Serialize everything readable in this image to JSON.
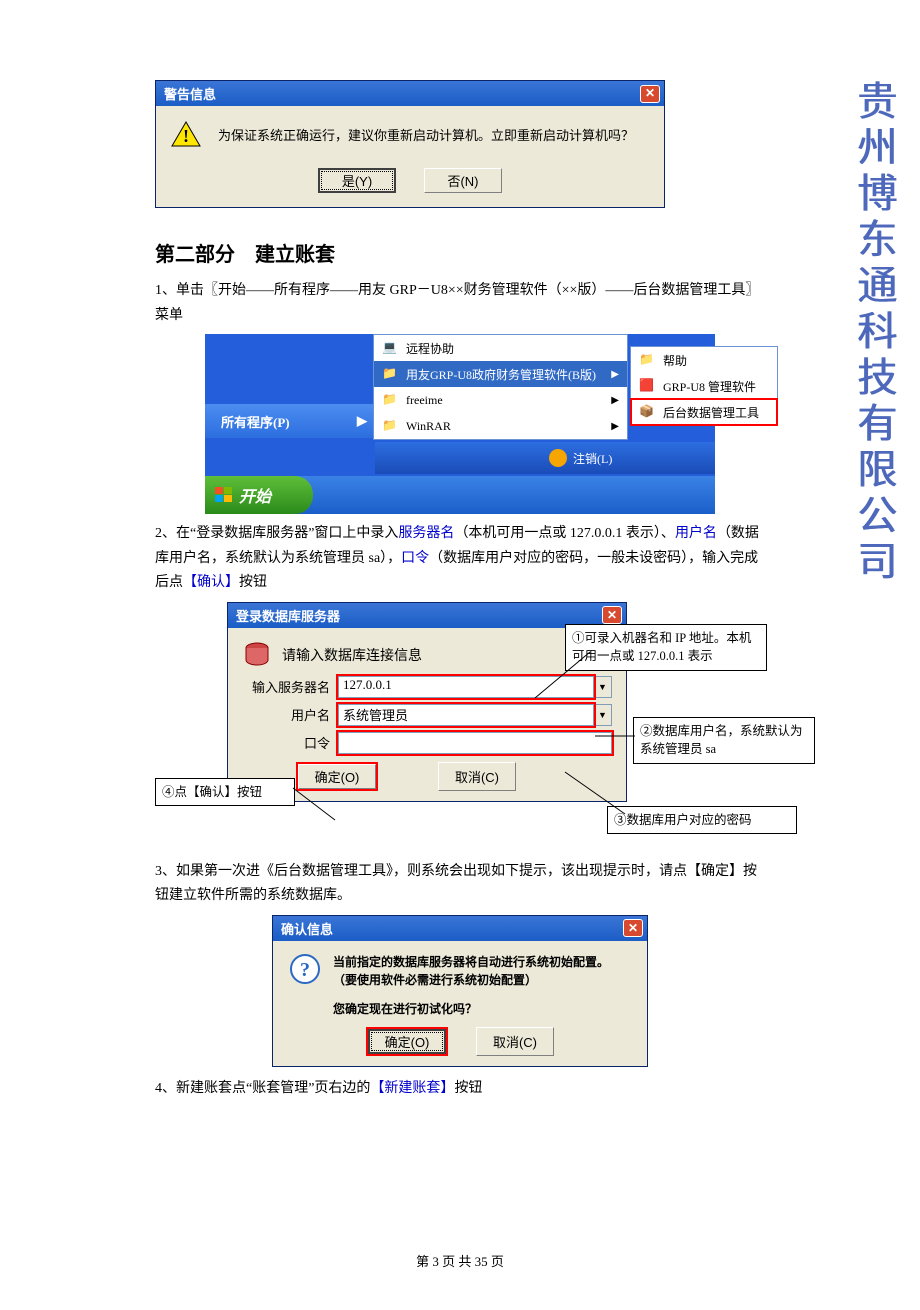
{
  "watermark": "贵州博东通科技有限公司",
  "dialog1": {
    "title": "警告信息",
    "message": "为保证系统正确运行，建议你重新启动计算机。立即重新启动计算机吗？",
    "yes": "是(Y)",
    "no": "否(N)"
  },
  "heading": "第二部分　建立账套",
  "para1": {
    "prefix": "1、单击〖开始——所有程序——用友 GRP－U8××财务管理软件（××版）——后台数据管理工具〗菜单"
  },
  "startmenu": {
    "all_programs": "所有程序(P)",
    "remote": "远程协助",
    "u8": "用友GRP-U8政府财务管理软件(B版)",
    "freeime": "freeime",
    "winrar": "WinRAR",
    "help": "帮助",
    "mgr": "GRP-U8 管理软件",
    "backend": "后台数据管理工具",
    "logoff": "注销(L)",
    "start": "开始"
  },
  "para2": {
    "a": "2、在“登录数据库服务器”窗口上中录入",
    "server": "服务器名",
    "b": "（本机可用一点或 127.0.0.1 表示）、",
    "user": "用户名",
    "c": "（数据库用户名，系统默认为系统管理员 sa），",
    "pwd": "口令",
    "d": "（数据库用户对应的密码，一般未设密码），输入完成后点",
    "confirm": "【确认】",
    "e": "按钮"
  },
  "logindlg": {
    "title": "登录数据库服务器",
    "subtitle": "请输入数据库连接信息",
    "server_label": "输入服务器名",
    "server_value": "127.0.0.1",
    "user_label": "用户名",
    "user_value": "系统管理员",
    "pwd_label": "口令",
    "ok": "确定(O)",
    "cancel": "取消(C)"
  },
  "callouts": {
    "c1": "①可录入机器名和 IP 地址。本机可用一点或 127.0.0.1 表示",
    "c2": "②数据库用户名，系统默认为系统管理员 sa",
    "c3": "③数据库用户对应的密码",
    "c4": "④点【确认】按钮"
  },
  "para3": "3、如果第一次进《后台数据管理工具》，则系统会出现如下提示，该出现提示时，请点【确定】按钮建立软件所需的系统数据库。",
  "confirmdlg": {
    "title": "确认信息",
    "line1": "当前指定的数据库服务器将自动进行系统初始配置。",
    "line2": "（要使用软件必需进行系统初始配置）",
    "line3": "您确定现在进行初试化吗？",
    "ok": "确定(O)",
    "cancel": "取消(C)"
  },
  "para4": {
    "a": "4、新建账套点“账套管理”页右边的",
    "btn": "【新建账套】",
    "b": "按钮"
  },
  "footer": "第 3 页 共 35 页"
}
